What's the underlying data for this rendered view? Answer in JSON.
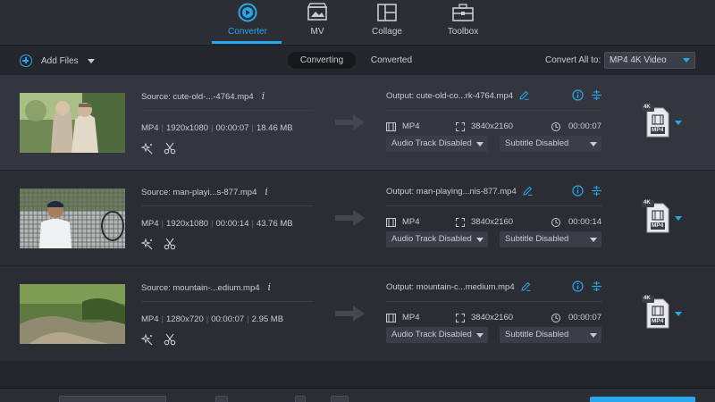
{
  "nav": {
    "tabs": [
      {
        "label": "Converter",
        "icon": "converter-icon",
        "active": true
      },
      {
        "label": "MV",
        "icon": "mv-icon",
        "active": false
      },
      {
        "label": "Collage",
        "icon": "collage-icon",
        "active": false
      },
      {
        "label": "Toolbox",
        "icon": "toolbox-icon",
        "active": false
      }
    ]
  },
  "toolbar": {
    "add_files_label": "Add Files",
    "tab_converting": "Converting",
    "tab_converted": "Converted",
    "convert_all_label": "Convert All to:",
    "convert_all_value": "MP4 4K Video"
  },
  "colors": {
    "accent": "#28a8ea",
    "background": "#23262d",
    "row_selected": "#33363e",
    "row": "#2a2d34"
  },
  "files": [
    {
      "source": "Source: cute-old-...-4764.mp4",
      "format": "MP4",
      "resolution": "1920x1080",
      "duration": "00:00:07",
      "size": "18.46 MB",
      "output": "Output: cute-old-co...rk-4764.mp4",
      "out_format": "MP4",
      "out_resolution": "3840x2160",
      "out_duration": "00:00:07",
      "audio": "Audio Track Disabled",
      "subtitle": "Subtitle Disabled",
      "badge_top": "4K",
      "badge_bottom": "MP4"
    },
    {
      "source": "Source: man-playi...s-877.mp4",
      "format": "MP4",
      "resolution": "1920x1080",
      "duration": "00:00:14",
      "size": "43.76 MB",
      "output": "Output: man-playing...nis-877.mp4",
      "out_format": "MP4",
      "out_resolution": "3840x2160",
      "out_duration": "00:00:14",
      "audio": "Audio Track Disabled",
      "subtitle": "Subtitle Disabled",
      "badge_top": "4K",
      "badge_bottom": "MP4"
    },
    {
      "source": "Source: mountain-...edium.mp4",
      "format": "MP4",
      "resolution": "1280x720",
      "duration": "00:00:07",
      "size": "2.95 MB",
      "output": "Output: mountain-c...medium.mp4",
      "out_format": "MP4",
      "out_resolution": "3840x2160",
      "out_duration": "00:00:07",
      "audio": "Audio Track Disabled",
      "subtitle": "Subtitle Disabled",
      "badge_top": "4K",
      "badge_bottom": "MP4"
    }
  ]
}
